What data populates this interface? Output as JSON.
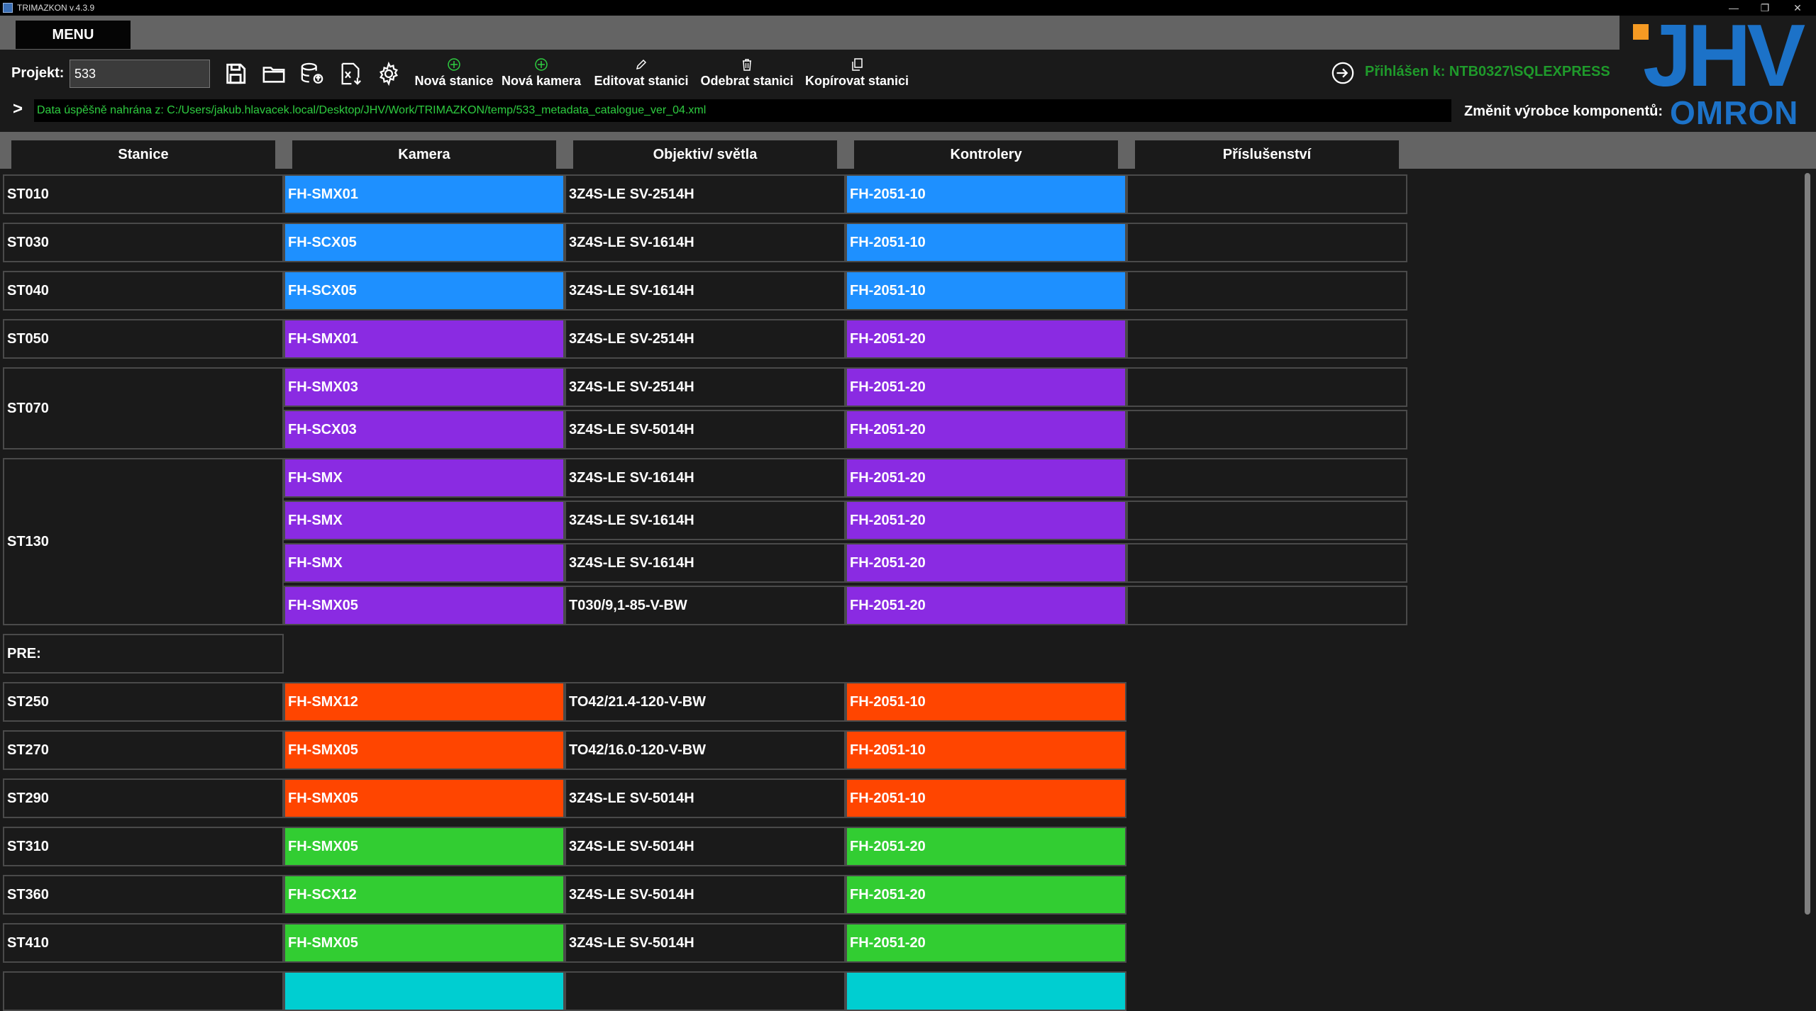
{
  "app": {
    "title": "TRIMAZKON v.4.3.9",
    "window_controls": [
      "—",
      "❐",
      "✕"
    ]
  },
  "menu": {
    "label": "MENU"
  },
  "toolbar": {
    "project_label": "Projekt:",
    "project_value": "533",
    "icons": [
      "save-icon",
      "open-folder-icon",
      "database-upload-icon",
      "excel-export-icon",
      "settings-gear-icon"
    ],
    "actions": [
      {
        "label": "Nová stanice",
        "icon": "plus-circle-icon"
      },
      {
        "label": "Nová kamera",
        "icon": "plus-circle-icon"
      },
      {
        "label": "Editovat stanici",
        "icon": "pencil-icon"
      },
      {
        "label": "Odebrat stanici",
        "icon": "trash-icon"
      },
      {
        "label": "Kopírovat stanici",
        "icon": "copy-icon"
      }
    ],
    "login_text": "Přihlášen k: NTB0327\\SQLEXPRESS"
  },
  "logo": {
    "brand": "JHV",
    "accent_color": "#f59a23",
    "brand_color": "#1c72c8"
  },
  "console": {
    "prompt": ">",
    "message": "Data úspěšně nahrána z: C:/Users/jakub.hlavacek.local/Desktop/JHV/Work/TRIMAZKON/temp/533_metadata_catalogue_ver_04.xml"
  },
  "manufacturer": {
    "label": "Změnit výrobce komponentů:",
    "value": "OMRON"
  },
  "columns": [
    "Stanice",
    "Kamera",
    "Objektiv/ světla",
    "Kontrolery",
    "Příslušenství"
  ],
  "colors": {
    "blue": "#1e90ff",
    "purple": "#8a2be2",
    "orange": "#ff4500",
    "green": "#32cd32",
    "cyan": "#00ced1",
    "dark": "#1a1a1a"
  },
  "rows": [
    {
      "station": "ST010",
      "color": "blue",
      "cameras": [
        {
          "camera": "FH-SMX01",
          "lens": "3Z4S-LE SV-2514H",
          "controller": "FH-2051-10",
          "accessory": ""
        }
      ]
    },
    {
      "station": "ST030",
      "color": "blue",
      "cameras": [
        {
          "camera": "FH-SCX05",
          "lens": "3Z4S-LE SV-1614H",
          "controller": "FH-2051-10",
          "accessory": ""
        }
      ]
    },
    {
      "station": "ST040",
      "color": "blue",
      "cameras": [
        {
          "camera": "FH-SCX05",
          "lens": "3Z4S-LE SV-1614H",
          "controller": "FH-2051-10",
          "accessory": ""
        }
      ]
    },
    {
      "station": "ST050",
      "color": "purple",
      "cameras": [
        {
          "camera": "FH-SMX01",
          "lens": "3Z4S-LE SV-2514H",
          "controller": "FH-2051-20",
          "accessory": ""
        }
      ]
    },
    {
      "station": "ST070",
      "color": "purple",
      "cameras": [
        {
          "camera": "FH-SMX03",
          "lens": "3Z4S-LE SV-2514H",
          "controller": "FH-2051-20",
          "accessory": ""
        },
        {
          "camera": "FH-SCX03",
          "lens": "3Z4S-LE SV-5014H",
          "controller": "FH-2051-20",
          "accessory": ""
        }
      ]
    },
    {
      "station": "ST130",
      "color": "purple",
      "cameras": [
        {
          "camera": "FH-SMX",
          "lens": "3Z4S-LE SV-1614H",
          "controller": "FH-2051-20",
          "accessory": ""
        },
        {
          "camera": "FH-SMX",
          "lens": "3Z4S-LE SV-1614H",
          "controller": "FH-2051-20",
          "accessory": ""
        },
        {
          "camera": "FH-SMX",
          "lens": "3Z4S-LE SV-1614H",
          "controller": "FH-2051-20",
          "accessory": ""
        },
        {
          "camera": "FH-SMX05",
          "lens": "T030/9,1-85-V-BW",
          "controller": "FH-2051-20",
          "accessory": ""
        }
      ]
    },
    {
      "station": "PRE:",
      "section": true,
      "cameras": []
    },
    {
      "station": "ST250",
      "color": "orange",
      "cameras": [
        {
          "camera": "FH-SMX12",
          "lens": "TO42/21.4-120-V-BW",
          "controller": "FH-2051-10"
        }
      ]
    },
    {
      "station": "ST270",
      "color": "orange",
      "cameras": [
        {
          "camera": "FH-SMX05",
          "lens": "TO42/16.0-120-V-BW",
          "controller": "FH-2051-10"
        }
      ]
    },
    {
      "station": "ST290",
      "color": "orange",
      "cameras": [
        {
          "camera": "FH-SMX05",
          "lens": "3Z4S-LE SV-5014H",
          "controller": "FH-2051-10"
        }
      ]
    },
    {
      "station": "ST310",
      "color": "green",
      "cameras": [
        {
          "camera": "FH-SMX05",
          "lens": "3Z4S-LE SV-5014H",
          "controller": "FH-2051-20"
        }
      ]
    },
    {
      "station": "ST360",
      "color": "green",
      "cameras": [
        {
          "camera": "FH-SCX12",
          "lens": "3Z4S-LE SV-5014H",
          "controller": "FH-2051-20"
        }
      ]
    },
    {
      "station": "ST410",
      "color": "green",
      "cameras": [
        {
          "camera": "FH-SMX05",
          "lens": "3Z4S-LE SV-5014H",
          "controller": "FH-2051-20"
        }
      ]
    },
    {
      "station": "",
      "color": "cyan",
      "partial": true,
      "cameras": [
        {
          "camera": "",
          "lens": "",
          "controller": ""
        }
      ]
    }
  ]
}
